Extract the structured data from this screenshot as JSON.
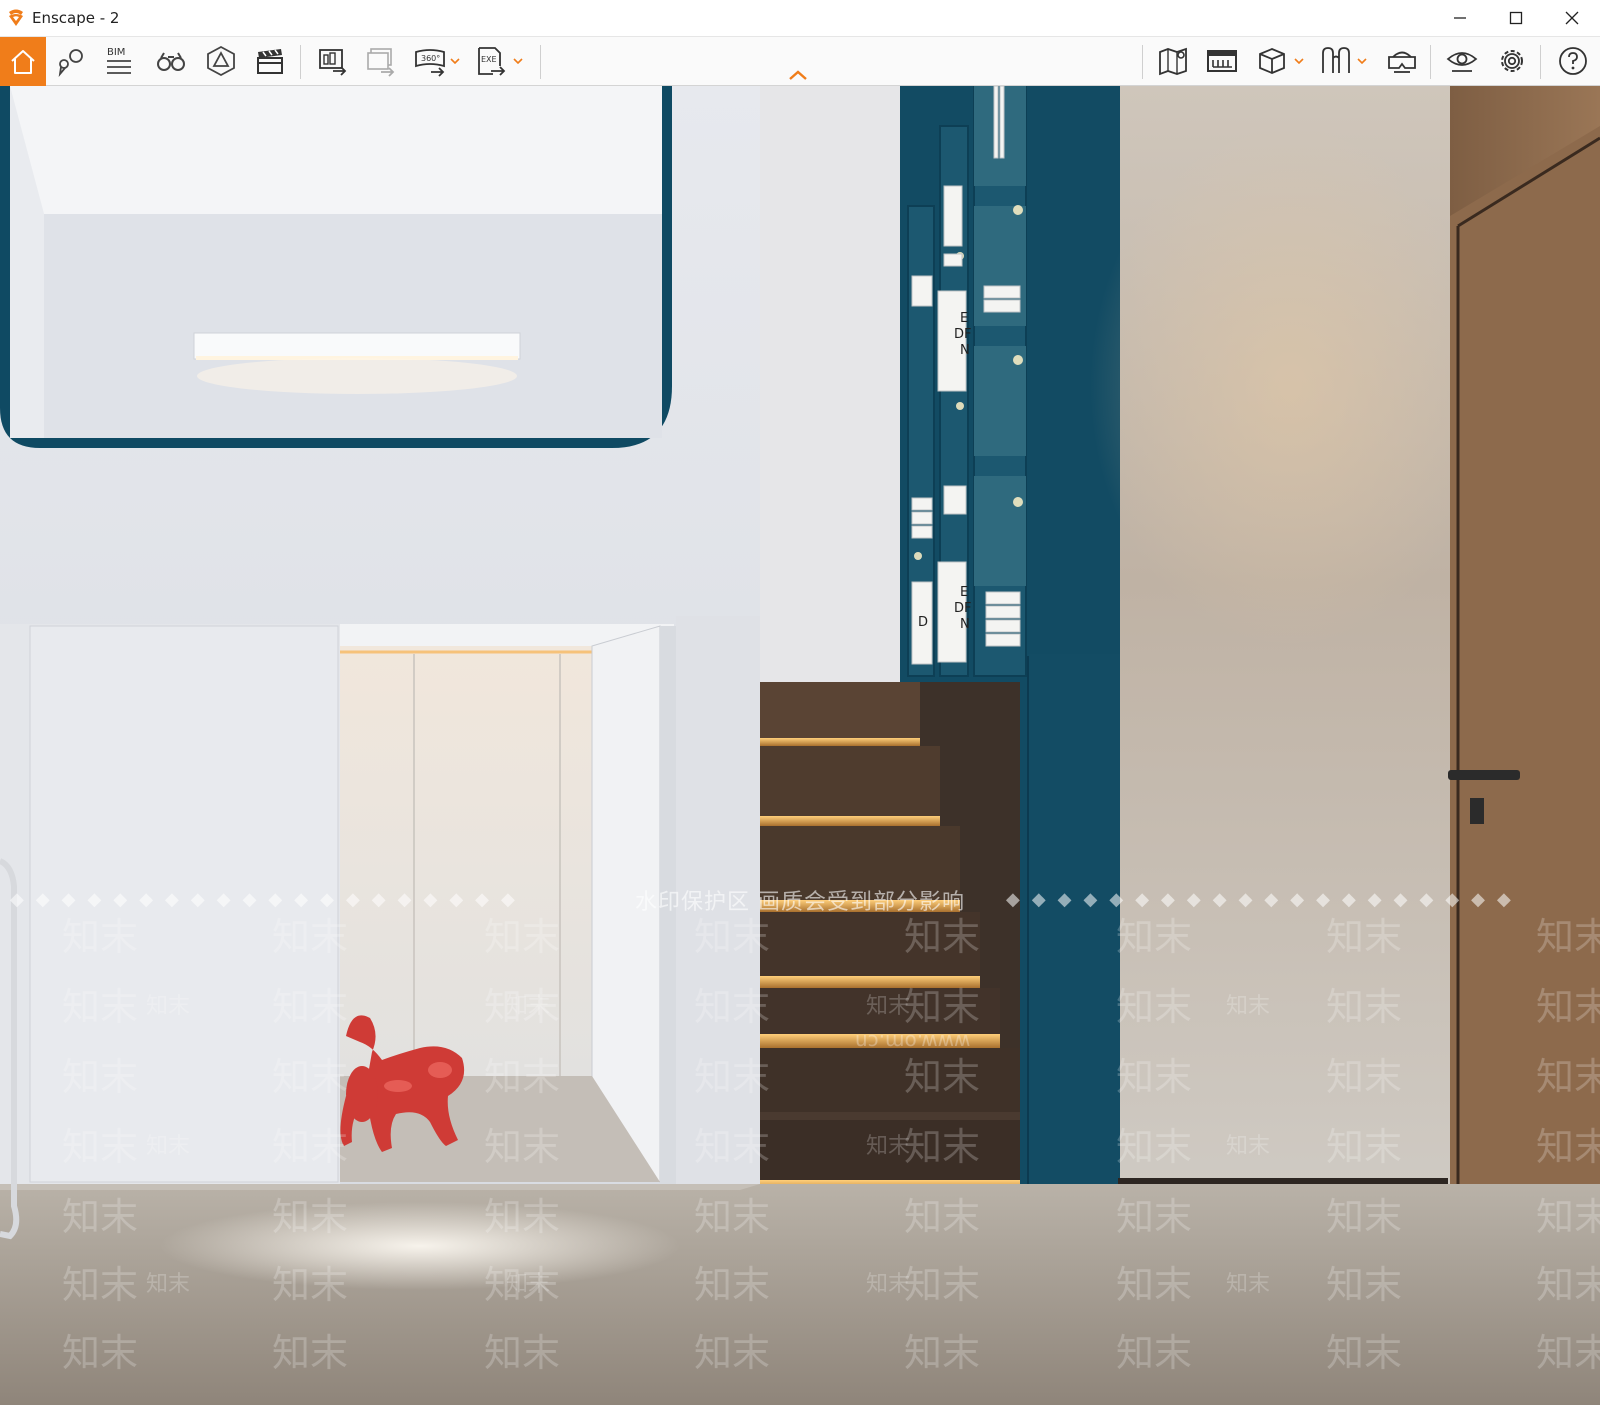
{
  "window": {
    "title": "Enscape - 2",
    "accent_color": "#f07d1a",
    "controls": [
      "minimize-icon",
      "maximize-icon",
      "close-icon"
    ]
  },
  "toolbar": {
    "left_tools": [
      {
        "icon": "home-icon",
        "active": true
      },
      {
        "icon": "views-icon"
      },
      {
        "icon": "bim-icon",
        "label": "BIM"
      },
      {
        "icon": "binoculars-icon"
      },
      {
        "icon": "asset-library-icon"
      },
      {
        "icon": "clapperboard-icon"
      },
      {
        "icon": "render-screenshot-icon"
      },
      {
        "icon": "batch-render-icon"
      },
      {
        "icon": "panorama-360-icon",
        "label": "360°",
        "has_dropdown": true
      },
      {
        "icon": "export-exe-icon",
        "label": "EXE",
        "has_dropdown": true
      }
    ],
    "right_tools": [
      {
        "icon": "map-icon"
      },
      {
        "icon": "bim-info-icon"
      },
      {
        "icon": "cube-view-icon",
        "has_dropdown": true
      },
      {
        "icon": "stereo-book-icon",
        "has_dropdown": true
      },
      {
        "icon": "vr-headset-icon"
      },
      {
        "icon": "visual-settings-eye-icon"
      },
      {
        "icon": "settings-gear-icon"
      },
      {
        "icon": "help-icon"
      }
    ],
    "collapse_icon": "chevron-up-icon"
  },
  "viewport": {
    "scene": "interior render: loft with staircase and blue bookshelf",
    "book_spine_text": [
      "E",
      "DF",
      "N",
      "E",
      "DF",
      "N",
      "D"
    ],
    "watermark": {
      "banner_text": "水印保护区  画质会受到部分影响",
      "brand": "知末",
      "url_text": "www.om.cn"
    }
  }
}
